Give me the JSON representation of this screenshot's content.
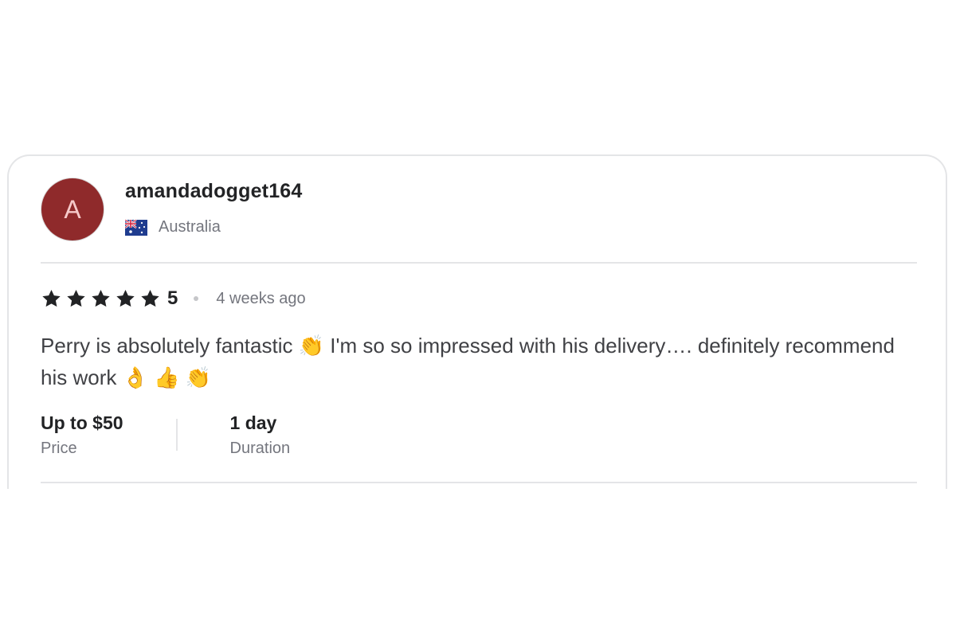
{
  "review": {
    "avatar_letter": "A",
    "username": "amandadogget164",
    "country": "Australia",
    "country_flag_icon": "australia-flag-icon",
    "rating": {
      "stars": 5,
      "max_stars": 5,
      "score_label": "5"
    },
    "time_ago": "4 weeks ago",
    "text": "Perry is absolutely fantastic 👏 I'm so so impressed with his delivery…. definitely recommend his work 👌 👍 👏",
    "price": {
      "value": "Up to $50",
      "label": "Price"
    },
    "duration": {
      "value": "1 day",
      "label": "Duration"
    }
  },
  "colors": {
    "avatar_bg": "#8f2a2b",
    "star": "#222325",
    "text": "#404145",
    "muted": "#74767e",
    "divider": "#e4e5e7"
  }
}
